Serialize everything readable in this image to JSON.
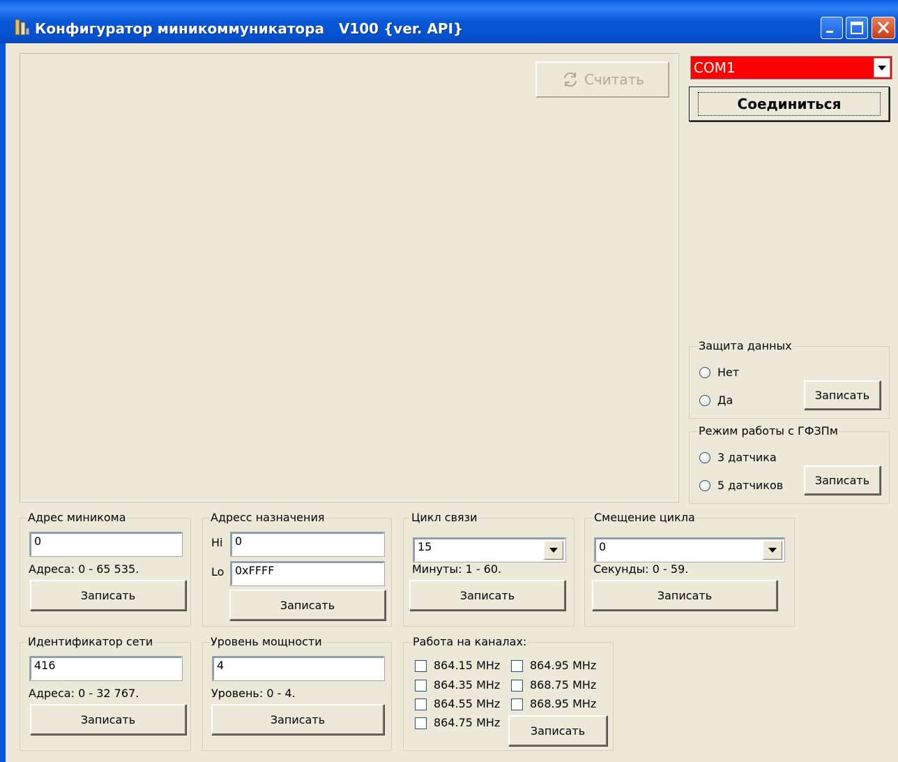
{
  "window": {
    "title": "Конфигуратор миникоммуникатора   V100 {ver. API}"
  },
  "toolbar": {
    "read_label": "Считать"
  },
  "connection": {
    "port_value": "COM1",
    "connect_label": "Соединиться"
  },
  "data_protection": {
    "title": "Защита данных",
    "option_no": "Нет",
    "option_yes": "Да",
    "write_label": "Записать"
  },
  "gfzpm_mode": {
    "title": "Режим работы с ГФЗПм",
    "option_3": "3 датчика",
    "option_5": "5 датчиков",
    "write_label": "Записать"
  },
  "minikom_address": {
    "title": "Адрес миникома",
    "value": "0",
    "hint": "Адреса: 0 - 65 535.",
    "write_label": "Записать"
  },
  "dest_address": {
    "title": "Адресс назначения",
    "hi_label": "Hi",
    "hi_value": "0",
    "lo_label": "Lo",
    "lo_value": "0xFFFF",
    "write_label": "Записать"
  },
  "comm_cycle": {
    "title": "Цикл связи",
    "value": "15",
    "hint": "Минуты: 1 - 60.",
    "write_label": "Записать"
  },
  "cycle_offset": {
    "title": "Смещение цикла",
    "value": "0",
    "hint": "Секунды: 0 - 59.",
    "write_label": "Записать"
  },
  "network_id": {
    "title": "Идентификатор сети",
    "value": "416",
    "hint": "Адреса: 0 - 32 767.",
    "write_label": "Записать"
  },
  "power_level": {
    "title": "Уровень мощности",
    "value": "4",
    "hint": "Уровень: 0 - 4.",
    "write_label": "Записать"
  },
  "channels": {
    "title": "Работа на каналах:",
    "items": [
      "864.15 MHz",
      "864.35 MHz",
      "864.55 MHz",
      "864.75 MHz",
      "864.95 MHz",
      "868.75 MHz",
      "868.95 MHz"
    ],
    "write_label": "Записать"
  },
  "colors": {
    "titlebar": "#0756d8",
    "port_bg": "#ff0000",
    "client_bg": "#ece9d8"
  }
}
